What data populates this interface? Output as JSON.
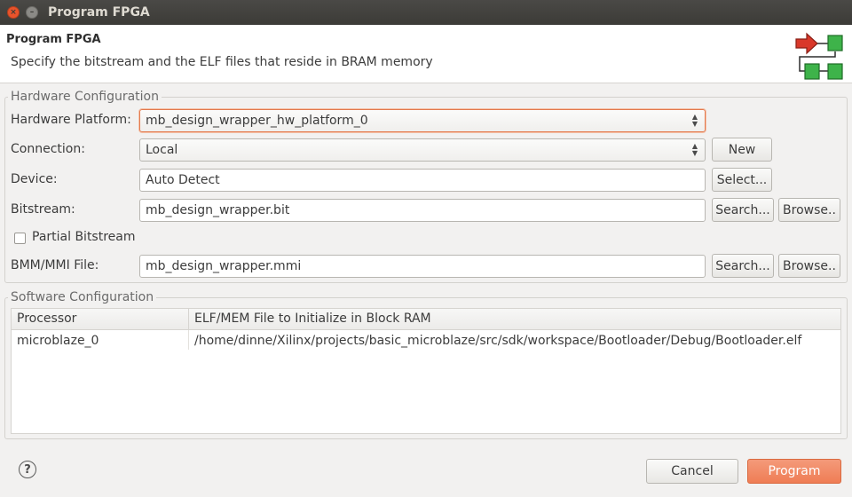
{
  "window": {
    "title": "Program FPGA",
    "close_glyph": "×",
    "minimize_glyph": "–"
  },
  "banner": {
    "title": "Program FPGA",
    "description": "Specify the bitstream and the ELF files that reside in BRAM memory",
    "logo_icon": "fpga-program-icon"
  },
  "hardware": {
    "legend": "Hardware Configuration",
    "platform_label": "Hardware Platform:",
    "platform_value": "mb_design_wrapper_hw_platform_0",
    "connection_label": "Connection:",
    "connection_value": "Local",
    "new_button": "New",
    "device_label": "Device:",
    "device_value": "Auto Detect",
    "select_button": "Select...",
    "bitstream_label": "Bitstream:",
    "bitstream_value": "mb_design_wrapper.bit",
    "search_button": "Search...",
    "browse_button": "Browse..",
    "partial_label": "Partial Bitstream",
    "partial_checked": false,
    "bmm_label": "BMM/MMI File:",
    "bmm_value": "mb_design_wrapper.mmi",
    "bmm_search_button": "Search...",
    "bmm_browse_button": "Browse.."
  },
  "software": {
    "legend": "Software Configuration",
    "columns": [
      "Processor",
      "ELF/MEM File to Initialize in Block RAM"
    ],
    "rows": [
      [
        "microblaze_0",
        "/home/dinne/Xilinx/projects/basic_microblaze/src/sdk/workspace/Bootloader/Debug/Bootloader.elf"
      ]
    ]
  },
  "footer": {
    "help_glyph": "?",
    "cancel_button": "Cancel",
    "program_button": "Program"
  },
  "colors": {
    "accent": "#ef7d55",
    "titlebar": "#3c3b37",
    "close": "#e9532b"
  }
}
